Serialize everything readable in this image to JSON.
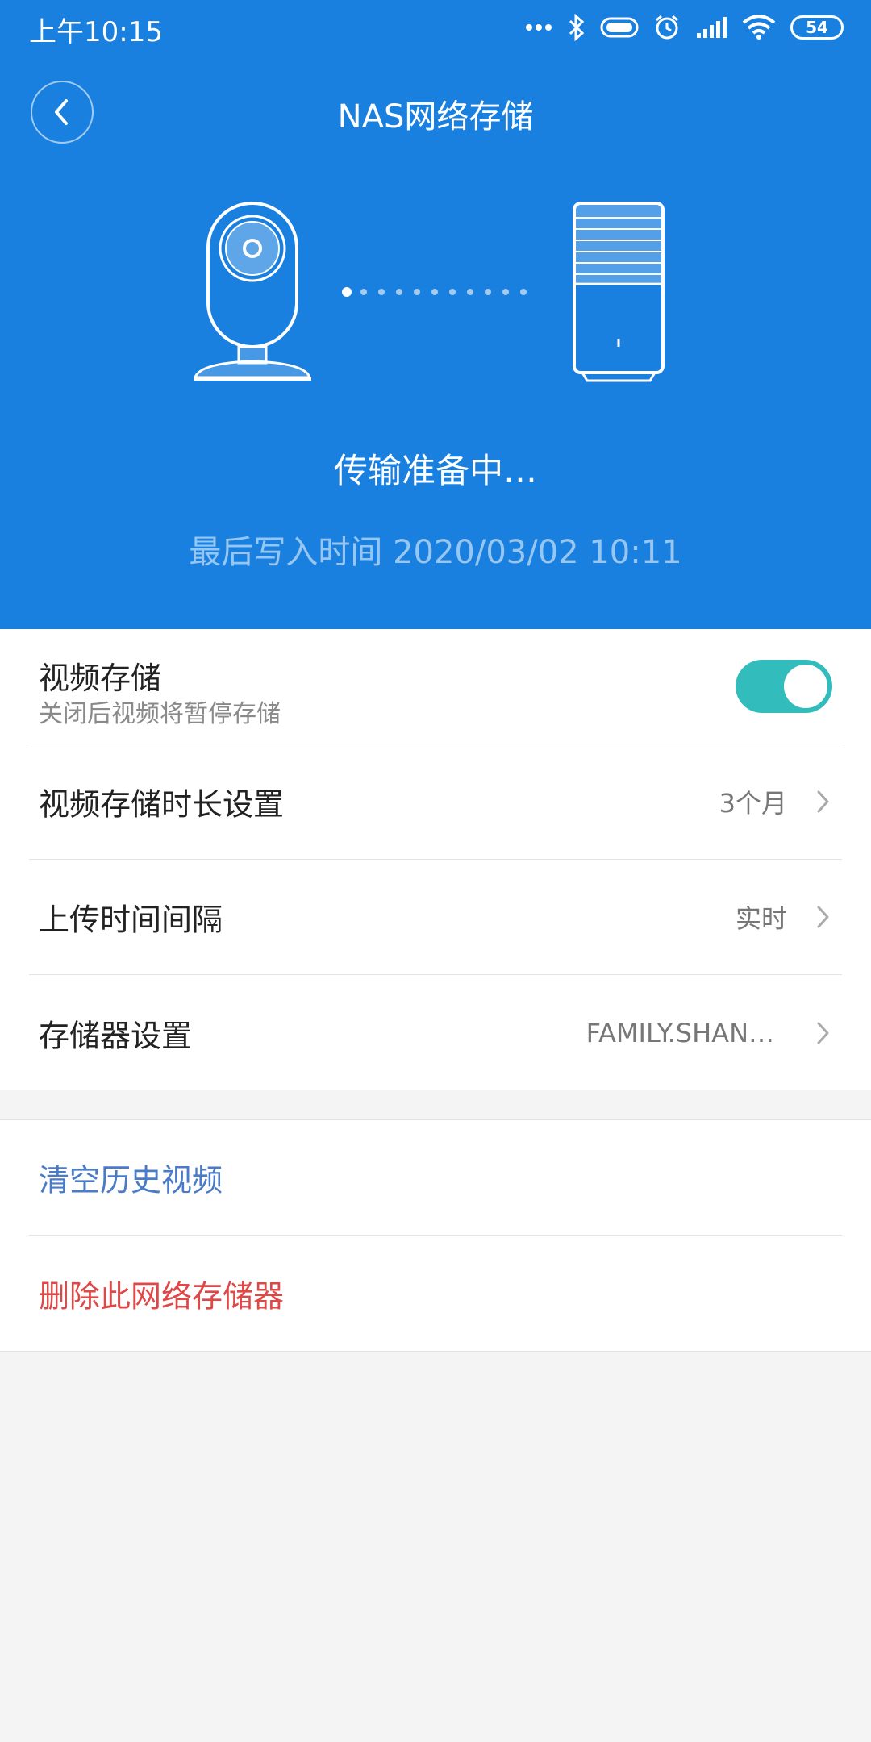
{
  "status_bar": {
    "time": "上午10:15",
    "battery": "54",
    "icons": [
      "more-dots-icon",
      "bluetooth-icon",
      "hd-voice-icon",
      "alarm-icon",
      "signal-icon",
      "wifi-icon",
      "battery-icon"
    ]
  },
  "header": {
    "title": "NAS网络存储",
    "status_text": "传输准备中…",
    "last_write": "最后写入时间 2020/03/02 10:11",
    "background_color": "#1a80e0"
  },
  "settings": {
    "video_storage": {
      "label": "视频存储",
      "sublabel": "关闭后视频将暂停存储",
      "enabled": true,
      "toggle_color": "#33bcbc"
    },
    "retention": {
      "label": "视频存储时长设置",
      "value": "3个月"
    },
    "upload_interval": {
      "label": "上传时间间隔",
      "value": "实时"
    },
    "storage_device": {
      "label": "存储器设置",
      "value": "FAMILY.SHAN…"
    }
  },
  "actions": {
    "clear_history": {
      "label": "清空历史视频",
      "color": "#4a7bc8"
    },
    "delete_storage": {
      "label": "删除此网络存储器",
      "color": "#e04848"
    }
  }
}
